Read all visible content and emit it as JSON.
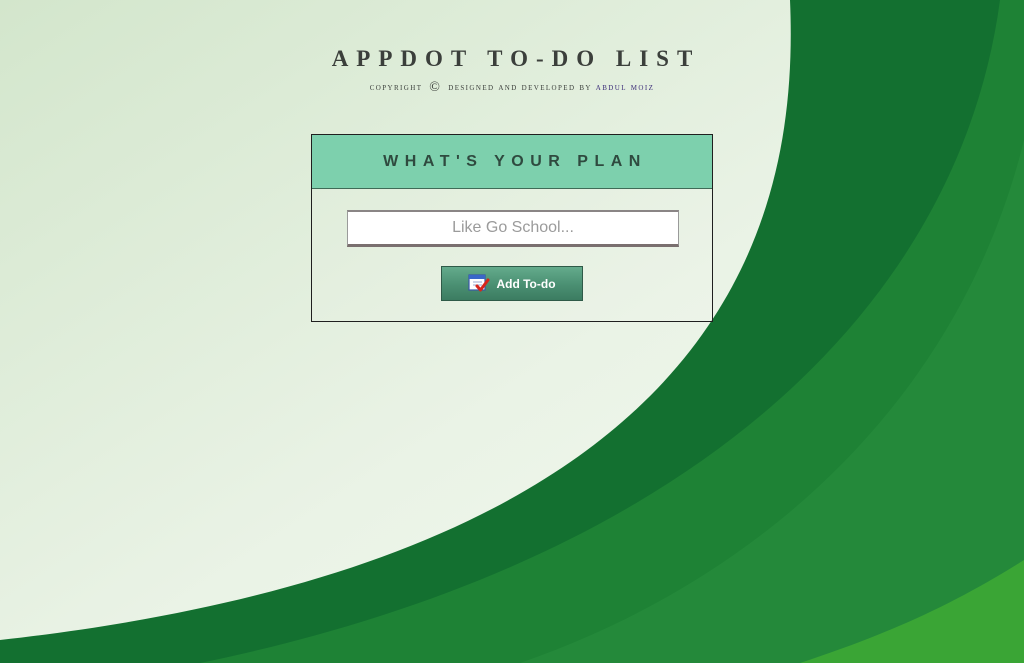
{
  "header": {
    "title": "APPDOT TO-DO LIST",
    "copyright_prefix": "COPYRIGHT",
    "copyright_symbol": "©",
    "copyright_middle": "DESIGNED AND DEVELOPED BY",
    "author": "ABDUL MOIZ"
  },
  "card": {
    "title": "WHAT'S YOUR PLAN",
    "input_placeholder": "Like Go School...",
    "input_value": "",
    "add_button_label": "Add To-do",
    "add_button_icon": "calendar-check-icon"
  },
  "colors": {
    "card_header": "#7dd0ad",
    "button": "#4a8f72",
    "wave_dark": "#137030",
    "wave_mid": "#22893a",
    "wave_light": "#3aa535"
  }
}
